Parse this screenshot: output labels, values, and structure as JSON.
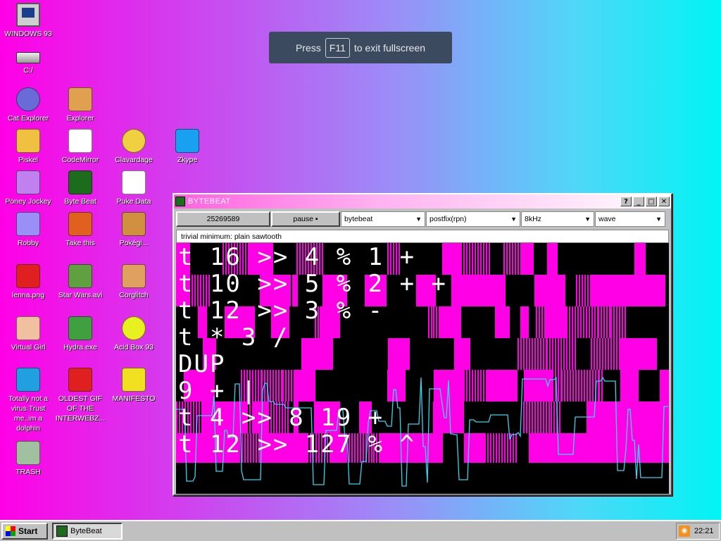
{
  "toast": {
    "before": "Press",
    "key": "F11",
    "after": "to exit fullscreen"
  },
  "desktop_icons": [
    {
      "label": "WINDOWS 93",
      "icon": "computer-icon",
      "color": "#cfcfcf"
    },
    {
      "label": "C:/",
      "icon": "drive-icon",
      "color": "#bbbbbb"
    },
    {
      "label": "Cat Explorer",
      "icon": "cat-explorer-icon",
      "color": "#6a6ad8"
    },
    {
      "label": "Explorer",
      "icon": "explorer-icon",
      "color": "#e0a050"
    },
    {
      "label": "Piskel",
      "icon": "palette-icon",
      "color": "#f0c040"
    },
    {
      "label": "CodeMirror",
      "icon": "codemirror-icon",
      "color": "#ffffff"
    },
    {
      "label": "Clavardage",
      "icon": "chat-icon",
      "color": "#f0d040"
    },
    {
      "label": "Zkype",
      "icon": "zkype-icon",
      "color": "#1aa0f0"
    },
    {
      "label": "Poney Jockey",
      "icon": "pony-icon",
      "color": "#c080f0"
    },
    {
      "label": "Byte Beat",
      "icon": "bytebeat-icon",
      "color": "#1d6b1d"
    },
    {
      "label": "Puke Data",
      "icon": "puredata-icon",
      "color": "#ffffff"
    },
    {
      "label": "Robby",
      "icon": "robby-icon",
      "color": "#9a8ff7"
    },
    {
      "label": "Take this",
      "icon": "take-this-icon",
      "color": "#e06020"
    },
    {
      "label": "Pokégi...",
      "icon": "pokegifts-icon",
      "color": "#d09040"
    },
    {
      "label": "lenna.png",
      "icon": "image-file-icon",
      "color": "#e02020"
    },
    {
      "label": "Star Wars.avi",
      "icon": "yoda-icon",
      "color": "#60a040"
    },
    {
      "label": "Corglitch",
      "icon": "corgi-icon",
      "color": "#e0a060"
    },
    {
      "label": "Virtual Girl",
      "icon": "virtual-girl-icon",
      "color": "#f0c0a0"
    },
    {
      "label": "Hydra.exe",
      "icon": "hydra-icon",
      "color": "#40a040"
    },
    {
      "label": "Acid Box 93",
      "icon": "acid-smiley-icon",
      "color": "#e8f020"
    },
    {
      "label": "Totally not a virus.Trust me..im a dolphin",
      "icon": "dolphin-icon",
      "color": "#20a0e0"
    },
    {
      "label": "OLDEST GIF OF THE INTERWEBZ...",
      "icon": "gif-file-icon",
      "color": "#e02020"
    },
    {
      "label": "MANIFESTO",
      "icon": "question-icon",
      "color": "#f0e020"
    },
    {
      "label": "TRASH",
      "icon": "trash-icon",
      "color": "#a0c0a0"
    }
  ],
  "window": {
    "title": "BYTEBEAT",
    "buttons": {
      "help": "?",
      "minimize": "_",
      "maximize": "□",
      "close": "✕"
    },
    "toolbar": {
      "counter": "25269589",
      "pause": "pause ▪",
      "mode": "bytebeat",
      "syntax": "postfix(rpn)",
      "rate": "8kHz",
      "view": "wave"
    },
    "formula": "trivial minimum: plain sawtooth",
    "code_lines": [
      "t 16 >> 4 % 1 +",
      "t 10 >> 5 % 2 + +",
      "t 12 >> 3 % -",
      "t * 3 /",
      "DUP",
      "9 + |",
      "t 4 >> 8 19 +",
      "t 12 >> 127 % ^"
    ]
  },
  "taskbar": {
    "start": "Start",
    "task": "ByteBeat",
    "clock": "22:21"
  },
  "colors": {
    "accent": "#ff00e6",
    "wave": "#33d6f0",
    "cyan": "#00f4f4"
  }
}
